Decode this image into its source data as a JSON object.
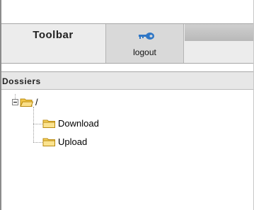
{
  "toolbar": {
    "title": "Toolbar",
    "logout_label": "logout",
    "logout_icon": "key-icon"
  },
  "dossiers": {
    "title": "Dossiers",
    "tree": {
      "root": {
        "label": "/",
        "expanded": true,
        "icon": "folder-open-icon"
      },
      "children": [
        {
          "label": "Download",
          "icon": "folder-icon"
        },
        {
          "label": "Upload",
          "icon": "folder-icon"
        }
      ]
    }
  },
  "colors": {
    "folder_fill": "#f7d35b",
    "folder_stroke": "#b98a10",
    "key_blue": "#2f77c6",
    "toolbar_bg": "#ececec",
    "header_bg": "#e7e7e7"
  }
}
